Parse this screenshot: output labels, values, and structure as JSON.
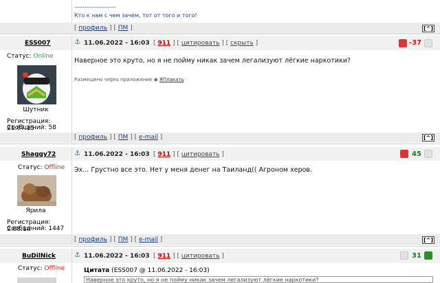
{
  "top_post": {
    "separator": "---------------------",
    "signature": "Кто к нам с чем зачем, тот от того и того!",
    "footer_profile": "профиль",
    "footer_pm": "ПМ",
    "top_button": "[^]"
  },
  "posts": [
    {
      "username": "ESS007",
      "status_label": "Статус:",
      "status": "Online",
      "avatar_caption": "Шутник",
      "reg_label": "Регистрация:",
      "reg_date": "21.07.15",
      "msgs_label": "Сообщений:",
      "msgs": "58",
      "date": "11.06.2022 - 16:03",
      "post_num": "911",
      "actions": [
        "цитировать",
        "скрыть"
      ],
      "score": "-37",
      "text": "Наверное это круто, но я не пойму никак зачем легализуют лёгкие наркотики?",
      "via_label": "Размещено через приложение",
      "via_app": "ЯПлакать",
      "footer": [
        "профиль",
        "ПМ",
        "e-mail"
      ],
      "top_button": "[^]"
    },
    {
      "username": "Shaggy72",
      "status_label": "Статус:",
      "status": "Offline",
      "avatar_caption": "Ярила",
      "reg_label": "Регистрация:",
      "reg_date": "2.08.14",
      "msgs_label": "Сообщений:",
      "msgs": "1447",
      "date": "11.06.2022 - 16:03",
      "post_num": "911",
      "actions": [
        "цитировать"
      ],
      "score": "45",
      "text": "Эх... Грустно все это. Нет у меня денег на Таиланд(( Агроном херов.",
      "footer": [
        "профиль",
        "ПМ",
        "e-mail"
      ],
      "top_button": "[^]"
    },
    {
      "username": "BuDilNick",
      "status_label": "Статус:",
      "status": "Offline",
      "date": "11.06.2022 - 16:03",
      "post_num": "911",
      "actions": [
        "цитировать"
      ],
      "score": "31",
      "quote_label": "Цитата",
      "quote_meta": "(ESS007 @ 11.06.2022 - 16:03)",
      "quote_text": "Наверное это круто, но я не пойму никак зачем легализуют лёгкие наркотики?"
    }
  ],
  "colors": {
    "link": "#1b3b8a",
    "online": "#2aa44a",
    "offline": "#d22222",
    "post_num": "#cc0000",
    "score_negative": "#d11111",
    "score_positive": "#1a7a1a",
    "vote_red": "#d9353b",
    "vote_green": "#2b8f2b"
  },
  "icons": [
    "anchor-icon",
    "thumb-down-icon",
    "thumb-up-icon",
    "phone-icon"
  ]
}
